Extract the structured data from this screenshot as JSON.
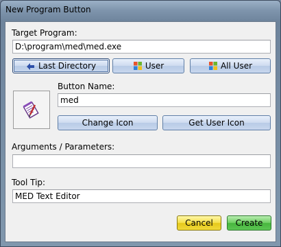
{
  "window": {
    "title": "New Program Button"
  },
  "target": {
    "label": "Target Program:",
    "value": "D:\\program\\med\\med.exe"
  },
  "target_buttons": [
    {
      "label": "Last Directory",
      "icon": "folder-arrow-icon"
    },
    {
      "label": "User",
      "icon": "windows-logo-icon"
    },
    {
      "label": "All User",
      "icon": "windows-logo-icon"
    }
  ],
  "button_name": {
    "label": "Button Name:",
    "value": "med"
  },
  "icon_buttons": {
    "change": "Change Icon",
    "get_user": "Get User Icon"
  },
  "arguments": {
    "label": "Arguments / Parameters:",
    "value": ""
  },
  "tooltip": {
    "label": "Tool Tip:",
    "value": "MED Text Editor"
  },
  "footer": {
    "cancel": "Cancel",
    "create": "Create"
  },
  "colors": {
    "cancel": "#f5e04a",
    "create": "#47b63e",
    "accent": "#5f7ea6"
  }
}
